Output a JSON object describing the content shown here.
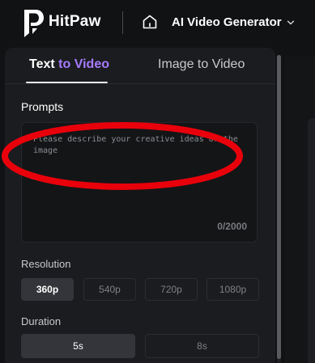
{
  "header": {
    "brand": "HitPaw",
    "product_label": "AI Video Generator",
    "icons": [
      "hitpaw-logo-icon",
      "home-icon",
      "chevron-down-icon"
    ]
  },
  "tabs": [
    {
      "label_part1": "Text ",
      "label_part2": "to",
      "label_part3": " Video",
      "active": true
    },
    {
      "label": "Image to Video",
      "active": false
    }
  ],
  "prompts": {
    "label": "Prompts",
    "placeholder": "Please describe your creative ideas or the image",
    "value": "",
    "char_count": "0/2000"
  },
  "resolution": {
    "label": "Resolution",
    "options": [
      "360p",
      "540p",
      "720p",
      "1080p"
    ],
    "selected": "360p"
  },
  "duration": {
    "label": "Duration",
    "options": [
      "5s",
      "8s"
    ],
    "selected": "5s"
  },
  "colors": {
    "background": "#111214",
    "panel": "#1b1c1f",
    "accent_purple": "#a77bff",
    "selected_button": "#34353a",
    "annotation_red": "#e8000b"
  }
}
